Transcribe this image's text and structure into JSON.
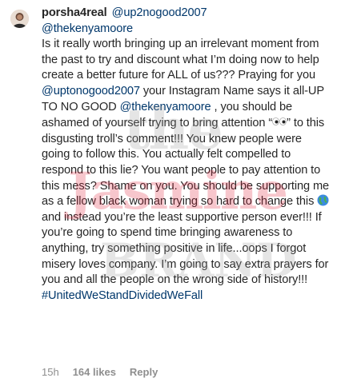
{
  "comment": {
    "username": "porsha4real",
    "mention_reply": "@up2nogood2007",
    "mention_kenya": "@thekenyamoore",
    "text_1": "Is it really worth bringing up an irrelevant moment from the past to try and discount what I’m doing now to help create a better future for ALL of us??? Praying for you ",
    "mention_2": "@uptonogood2007",
    "text_2": " your Instagram Name says it all-UP TO NO GOOD ",
    "mention_3": "@thekenyamoore",
    "text_3": " , you should be ashamed of yourself trying to bring attention “",
    "text_4": "” to this disgusting troll’s comment!!! You knew people were going to follow  this. You actually felt compelled to respond to this lie? You want people to pay attention to this mess? Shame on you. You should be supporting me as a fellow black woman trying so hard to change this ",
    "text_5": " and instead you’re the least supportive person ever!!! If you’re going to spend time bringing awareness to anything, try something positive in life...oops I forgot misery loves company. I’m going to say extra prayers for you and all the people on the wrong side of history!!! ",
    "hashtag": "#UnitedWeStandDividedWeFall",
    "eyes_icon": "eyes-emoji",
    "earth_icon": "earth-globe-emoji"
  },
  "meta": {
    "time": "15h",
    "likes": "164 likes",
    "reply": "Reply"
  },
  "watermark": {
    "line1": "the",
    "line2": "Jasmine",
    "line3": "BRAND"
  },
  "colors": {
    "text": "#262626",
    "link": "#00376b",
    "meta": "#8e8e8e"
  }
}
